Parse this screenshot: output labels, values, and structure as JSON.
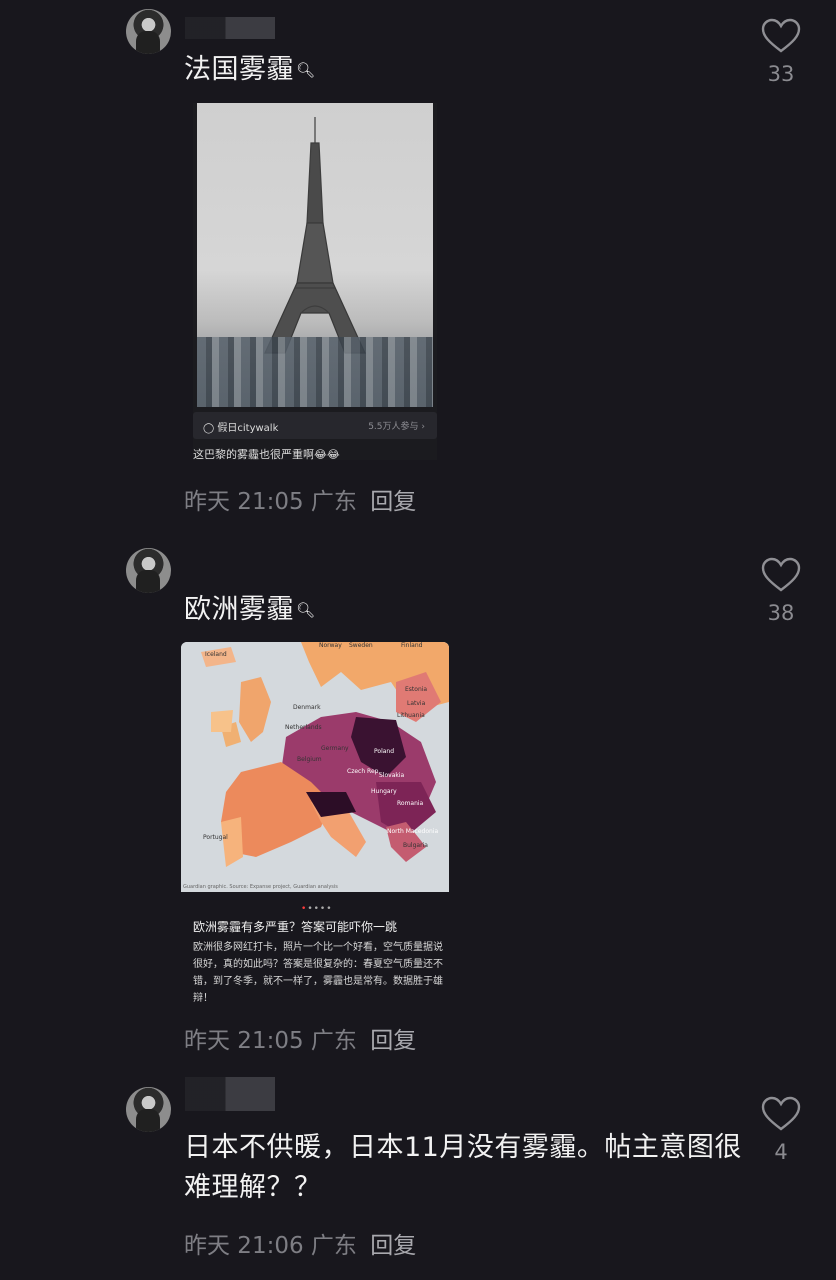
{
  "comments": [
    {
      "text": "法国雾霾",
      "time": "昨天 21:05",
      "location": "广东",
      "reply_label": "回复",
      "likes": "33",
      "card": {
        "badge_label": "假日citywalk",
        "badge_count": "5.5万人参与",
        "caption": "这巴黎的雾霾也很严重啊😂😂"
      }
    },
    {
      "text": "欧洲雾霾",
      "time": "昨天 21:05",
      "location": "广东",
      "reply_label": "回复",
      "likes": "38",
      "card": {
        "map_labels": {
          "iceland": "Iceland",
          "norway": "Norway",
          "sweden": "Sweden",
          "finland": "Finland",
          "estonia": "Estonia",
          "latvia": "Latvia",
          "lithuania": "Lithuania",
          "denmark": "Denmark",
          "netherlands": "Netherlands",
          "germany": "Germany",
          "poland": "Poland",
          "belgium": "Belgium",
          "czech": "Czech Rep.",
          "slovakia": "Slovakia",
          "hungary": "Hungary",
          "romania": "Romania",
          "bulgaria": "Bulgaria",
          "north_macedonia": "North Macedonia",
          "portugal": "Portugal"
        },
        "source": "Guardian graphic. Source: Expanse project, Guardian analysis",
        "title": "欧洲雾霾有多严重？答案可能吓你一跳",
        "body": "欧洲很多网红打卡，照片一个比一个好看，空气质量据说很好，真的如此吗？答案是很复杂的：春夏空气质量还不错，到了冬季，就不一样了，雾霾也是常有。数据胜于雄辩！"
      }
    },
    {
      "text": "日本不供暖，日本11月没有雾霾。帖主意图很难理解？？",
      "time": "昨天 21:06",
      "location": "广东",
      "reply_label": "回复",
      "likes": "4"
    }
  ],
  "icons": {
    "like": "heart-outline-icon",
    "search": "search-icon"
  },
  "colors": {
    "background": "#18171d",
    "text": "#f2f2f2",
    "meta": "#7e7e84"
  }
}
